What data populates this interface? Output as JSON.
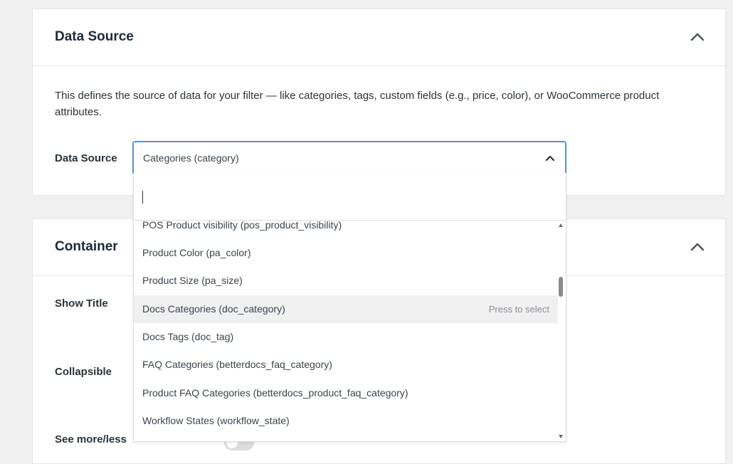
{
  "data_source_panel": {
    "title": "Data Source",
    "description": "This defines the source of data for your filter — like categories, tags, custom fields (e.g., price, color), or WooCommerce product attributes.",
    "field_label": "Data Source",
    "selected_value": "Categories (category)",
    "search_value": "",
    "options": [
      {
        "label": "POS Product visibility (pos_product_visibility)",
        "hint": ""
      },
      {
        "label": "Product Color (pa_color)",
        "hint": ""
      },
      {
        "label": "Product Size (pa_size)",
        "hint": ""
      },
      {
        "label": "Docs Categories (doc_category)",
        "hint": "Press to select"
      },
      {
        "label": "Docs Tags (doc_tag)",
        "hint": ""
      },
      {
        "label": "FAQ Categories (betterdocs_faq_category)",
        "hint": ""
      },
      {
        "label": "Product FAQ Categories (betterdocs_product_faq_category)",
        "hint": ""
      },
      {
        "label": "Workflow States (workflow_state)",
        "hint": ""
      }
    ],
    "highlighted_option": "Docs Categories (doc_category)"
  },
  "container_panel": {
    "title": "Container",
    "fields": [
      {
        "label": "Show Title"
      },
      {
        "label": "Collapsible"
      },
      {
        "label": "See more/less",
        "toggle_on": false
      }
    ]
  },
  "colors": {
    "accent": "#4f94d4",
    "background": "#f0f0f1",
    "highlight": "#f0f0f1"
  }
}
